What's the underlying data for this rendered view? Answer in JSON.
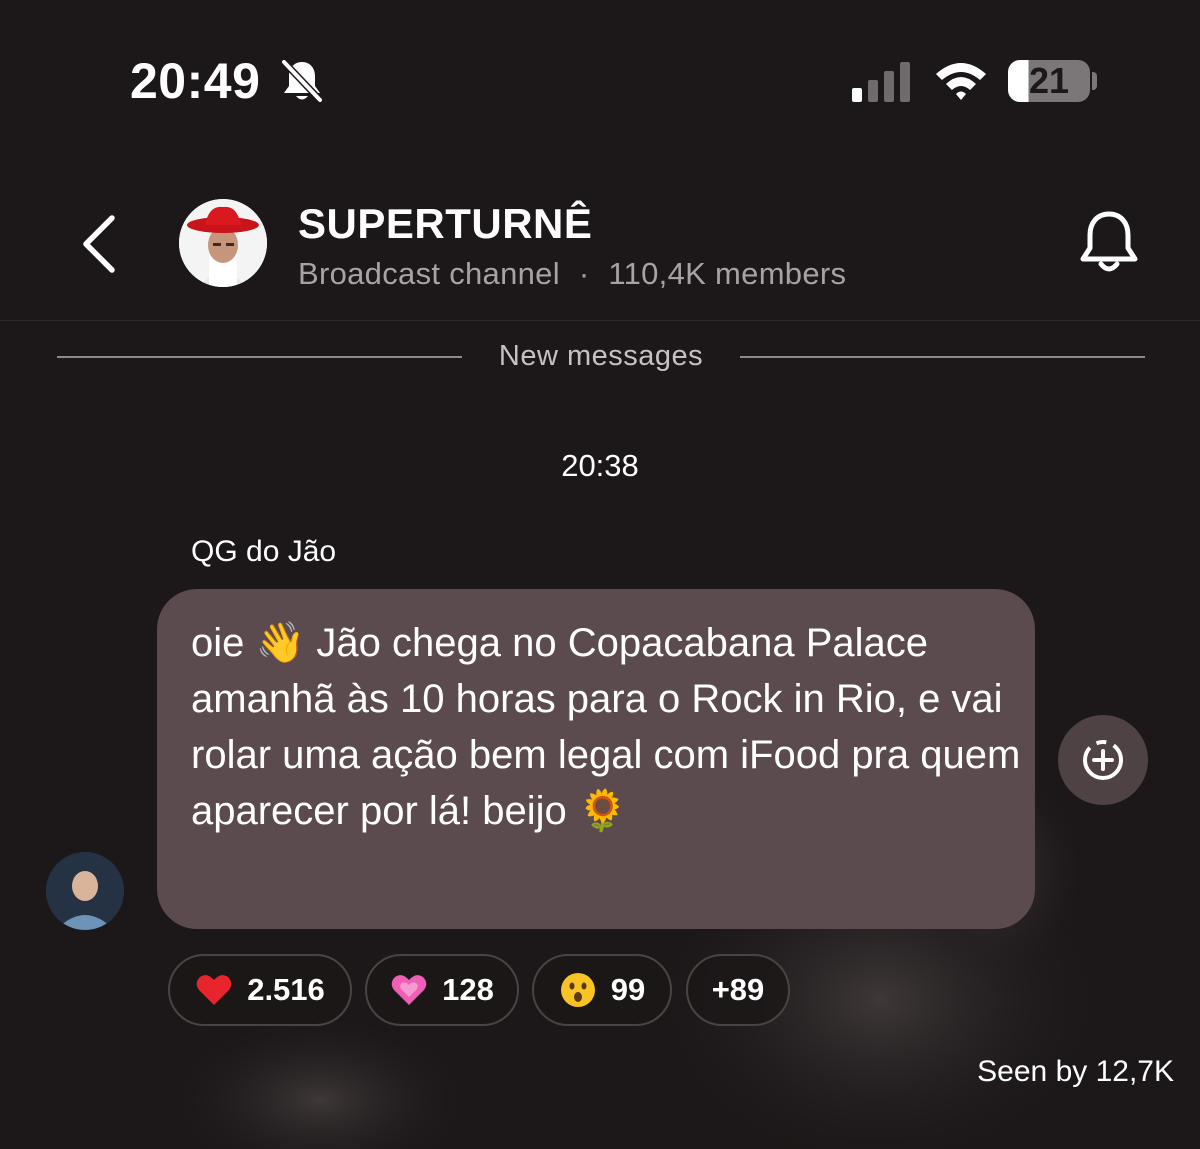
{
  "status_bar": {
    "time": "20:49",
    "battery_level": "21",
    "icons": [
      "bell-slash-icon",
      "cellular-signal-icon",
      "wifi-icon",
      "battery-icon"
    ]
  },
  "header": {
    "back_icon": "chevron-left-icon",
    "title": "SUPERTURNÊ",
    "channel_type": "Broadcast channel",
    "separator": "·",
    "members": "110,4K members",
    "bell_icon": "bell-icon"
  },
  "divider": {
    "label": "New messages"
  },
  "timestamp": "20:38",
  "message": {
    "sender": "QG do Jão",
    "text": "oie 👋 Jão chega no Copacabana Palace amanhã às 10 horas para o Rock in Rio, e vai rolar uma ação bem legal com iFood pra quem aparecer por lá! beijo 🌻",
    "add_reaction_icon": "add-reaction-icon"
  },
  "reactions": [
    {
      "emoji": "❤️",
      "count": "2.516"
    },
    {
      "emoji": "💗",
      "count": "128"
    },
    {
      "emoji": "😮",
      "count": "99"
    },
    {
      "emoji": "",
      "count": "+89"
    }
  ],
  "seen_by": "Seen by 12,7K",
  "colors": {
    "background": "#1c1718",
    "bubble": "#5c4b4e",
    "muted_text": "#a8a2a3",
    "pill_border": "#4d4243"
  }
}
